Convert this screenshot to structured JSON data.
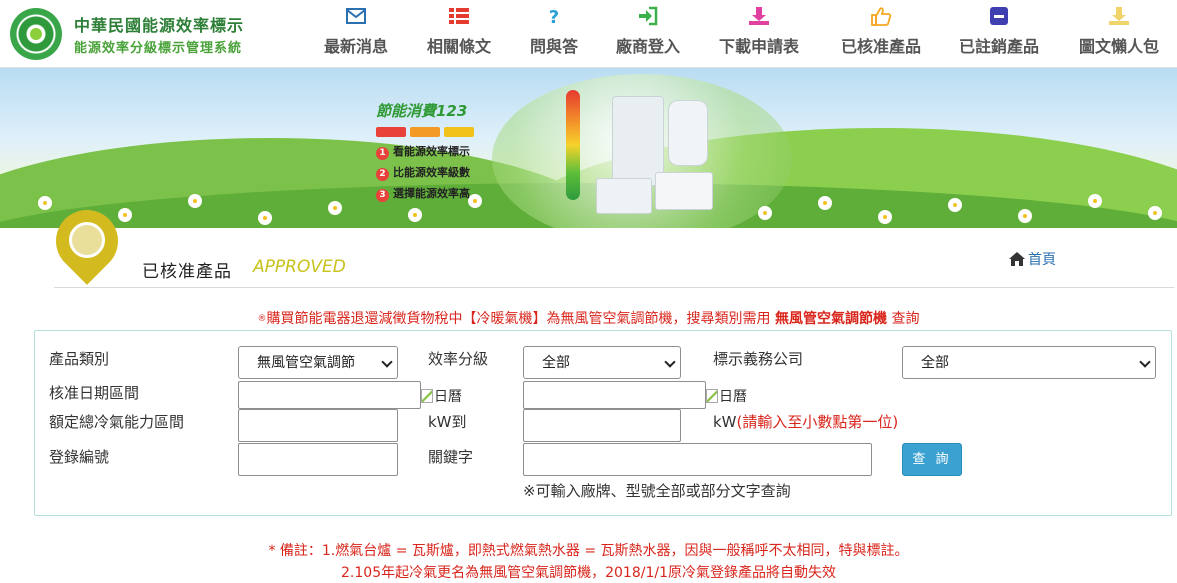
{
  "header": {
    "site_title": "中華民國能源效率標示",
    "site_subtitle": "能源效率分級標示管理系統",
    "nav": [
      {
        "label": "最新消息",
        "icon": "envelope-icon",
        "color": "#2a6fb0"
      },
      {
        "label": "相關條文",
        "icon": "list-icon",
        "color": "#e53a2e"
      },
      {
        "label": "問與答",
        "icon": "question-icon",
        "color": "#2aa0d8"
      },
      {
        "label": "廠商登入",
        "icon": "sign-in-icon",
        "color": "#3cb04a"
      },
      {
        "label": "下載申請表",
        "icon": "download-icon",
        "color": "#e040a0"
      },
      {
        "label": "已核准產品",
        "icon": "thumbs-up-icon",
        "color": "#f5a623"
      },
      {
        "label": "已註銷產品",
        "icon": "minus-square-icon",
        "color": "#3f3fb0"
      },
      {
        "label": "圖文懶人包",
        "icon": "download-light-icon",
        "color": "#f0d46a"
      }
    ]
  },
  "banner": {
    "title": "節能消費123",
    "steps": [
      {
        "num": "1",
        "text": "看能源效率標示"
      },
      {
        "num": "2",
        "text": "比能源效率級數"
      },
      {
        "num": "3",
        "text": "選擇能源效率高"
      }
    ]
  },
  "page": {
    "title": "已核准產品",
    "title_en": "APPROVED",
    "home_label": "首頁"
  },
  "notice": {
    "icon": "®",
    "part1": "購買節能電器退還減徵貨物稅中【冷暖氣機】為無風管空氣調節機，搜尋類別需用 ",
    "part2": "無風管空氣調節機",
    "part3": " 查詢"
  },
  "form": {
    "category_label": "產品類別",
    "category_value": "無風管空氣調節",
    "efficiency_label": "效率分級",
    "efficiency_value": "全部",
    "company_label": "標示義務公司",
    "company_value": "全部",
    "date_label": "核准日期區間",
    "calendar_alt": "日曆",
    "capacity_label": "額定總冷氣能力區間",
    "capacity_unit_to": "kW到",
    "capacity_unit": "kW",
    "capacity_hint": "(請輸入至小數點第一位)",
    "reg_label": "登錄編號",
    "keyword_label": "關鍵字",
    "keyword_hint": "※可輸入廠牌、型號全部或部分文字查詢",
    "query_button": "查 詢"
  },
  "footnotes": {
    "line1": "* 備註：1.燃氣台爐 = 瓦斯爐，即熱式燃氣熱水器 = 瓦斯熱水器，因與一般稱呼不太相同，特與標註。",
    "line2": "2.105年起冷氣更名為無風管空氣調節機，2018/1/1原冷氣登錄產品將自動失效"
  }
}
